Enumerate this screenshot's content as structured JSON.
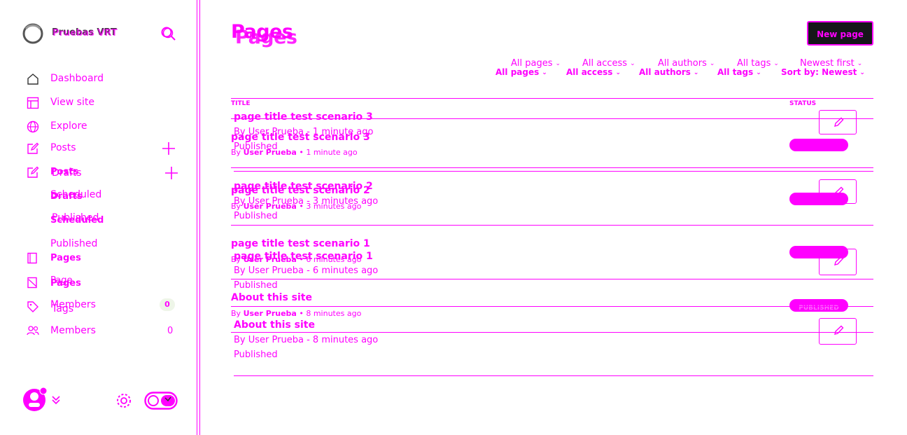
{
  "colors": {
    "accent": "#ff00ff",
    "button_bg": "#15171a",
    "background": "#ffffff"
  },
  "sidebar": {
    "site_title": "Pruebas VRT",
    "nav": {
      "dashboard": "Dashboard",
      "view_site": "View site",
      "explore": "Explore",
      "posts": "Posts",
      "drafts": "Drafts",
      "scheduled": "Scheduled",
      "published": "Published",
      "pages": "Pages",
      "tags": "Tags",
      "members": "Members",
      "members_count": "0"
    },
    "ghost_nav": {
      "posts": "Posts",
      "drafts": "Drafts",
      "scheduled": "Scheduled",
      "published": "Published",
      "pages": "Pages",
      "page": "Page",
      "members": "Members",
      "members_count": "0"
    }
  },
  "header": {
    "title": "Pages",
    "new_button": "New page",
    "filters": [
      "All pages",
      "All access",
      "All authors",
      "All tags",
      "Newest first"
    ],
    "filters_secondary": [
      "All pages",
      "All access",
      "All authors",
      "All tags",
      "Sort by: Newest"
    ]
  },
  "table": {
    "col_title": "TITLE",
    "col_status": "STATUS",
    "rows": [
      {
        "title": "page title test scenario 3",
        "author_prefix": "By",
        "author": "User Prueba",
        "time": "1 minute ago",
        "status": "Published"
      },
      {
        "title": "page title test scenario 2",
        "author_prefix": "By",
        "author": "User Prueba",
        "time": "3 minutes ago",
        "status": "Published"
      },
      {
        "title": "page title test scenario 1",
        "author_prefix": "By",
        "author": "User Prueba",
        "time": "6 minutes ago",
        "status": "Published"
      },
      {
        "title": "About this site",
        "author_prefix": "By",
        "author": "User Prueba",
        "time": "8 minutes ago",
        "status": "Published"
      }
    ],
    "status_badge": "PUBLISHED"
  },
  "icons": {
    "logo": "site-logo-icon",
    "search": "search-icon",
    "dashboard": "home-icon",
    "view_site": "browser-icon",
    "explore": "globe-icon",
    "posts": "pencil-square-icon",
    "pages": "page-icon",
    "tags": "tag-icon",
    "members": "members-icon",
    "settings": "gear-icon",
    "night_mode": "toggle-icon",
    "edit": "edit-pencil-icon"
  }
}
